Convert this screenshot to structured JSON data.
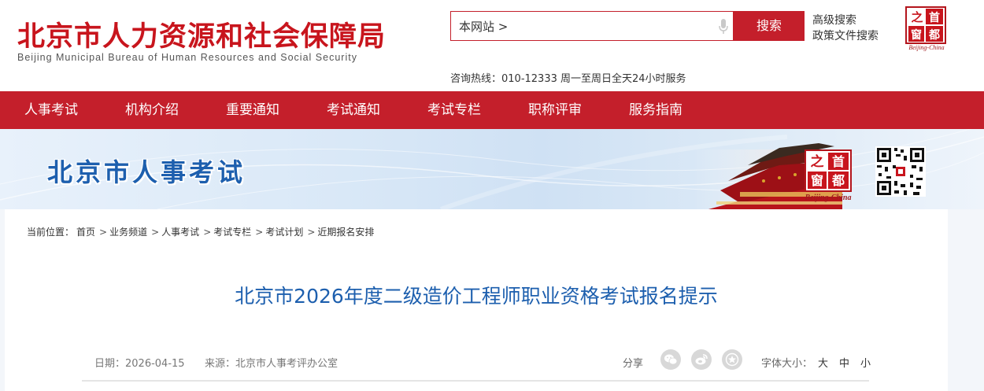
{
  "header": {
    "logo_cn": "北京市人力资源和社会保障局",
    "logo_en": "Beijing Municipal Bureau of Human Resources and Social Security",
    "search_scope": "本网站 >",
    "search_button": "搜索",
    "advanced_search": "高级搜索",
    "policy_search": "政策文件搜索",
    "hotline": "咨询热线：010-12333 周一至周日全天24小时服务",
    "badge": {
      "chars": [
        "之",
        "首",
        "窗",
        "都"
      ],
      "caption": "Beijing-China"
    }
  },
  "nav": {
    "items": [
      {
        "label": "人事考试"
      },
      {
        "label": "机构介绍"
      },
      {
        "label": "重要通知"
      },
      {
        "label": "考试通知"
      },
      {
        "label": "考试专栏"
      },
      {
        "label": "职称评审"
      },
      {
        "label": "服务指南"
      }
    ]
  },
  "banner": {
    "title": "北京市人事考试",
    "badge": {
      "chars": [
        "之",
        "首",
        "窗",
        "都"
      ],
      "caption": "Beijing-China"
    }
  },
  "breadcrumb": {
    "prefix": "当前位置：",
    "items": [
      "首页",
      "业务频道",
      "人事考试",
      "考试专栏",
      "考试计划",
      "近期报名安排"
    ]
  },
  "article": {
    "title": "北京市2026年度二级造价工程师职业资格考试报名提示",
    "date_label": "日期：",
    "date": "2026-04-15",
    "source_label": "来源：",
    "source": "北京市人事考评办公室",
    "share_label": "分享",
    "share_icons": [
      "wechat-icon",
      "weibo-icon",
      "favorite-icon"
    ],
    "font_size_label": "字体大小：",
    "font_sizes": [
      "大",
      "中",
      "小"
    ]
  },
  "colors": {
    "brand_red": "#c41f2b",
    "title_blue": "#1d5fae"
  }
}
